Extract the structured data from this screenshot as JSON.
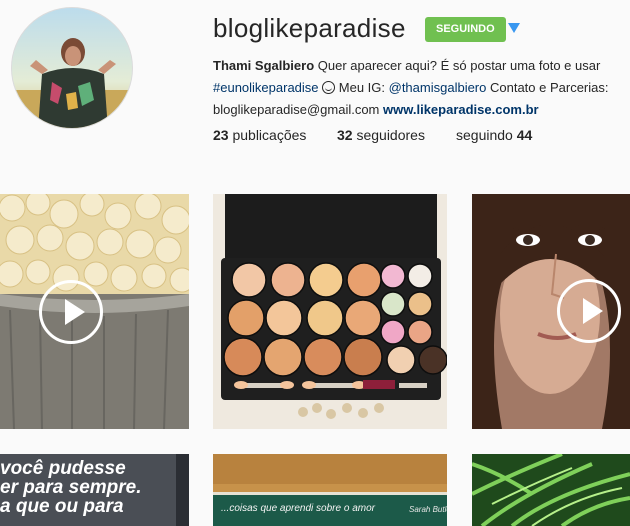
{
  "profile": {
    "username": "bloglikeparadise",
    "follow_label": "SEGUINDO",
    "bio": {
      "name": "Thami Sgalbiero",
      "line1": " Quer aparecer aqui? É só postar uma foto e usar",
      "hashtag": "#eunolikeparadise",
      "mid": " Meu IG: ",
      "mention": "@thamisgalbiero",
      "after_mention": " Contato e Parcerias:",
      "email": "bloglikeparadise@gmail.com ",
      "website": "www.likeparadise.com.br"
    },
    "stats": {
      "posts_count": "23",
      "posts_label": " publicações",
      "followers_count": "32",
      "followers_label": " seguidores",
      "following_label": "seguindo ",
      "following_count": "44"
    }
  },
  "grid": {
    "quote": {
      "line1": "você pudesse",
      "line2": "er para sempre.",
      "line3": "a que ou para"
    },
    "notebook": {
      "text": "...coisas que aprendi sobre o amor",
      "signature": "Sarah Butler"
    }
  },
  "colors": {
    "follow_button": "#70c050",
    "dropdown_arrow": "#3897f0",
    "link": "#003569"
  },
  "icons": {
    "video_play": "play-circle-icon",
    "dropdown": "triangle-down-icon",
    "emoji": "smile-emoji-icon"
  }
}
